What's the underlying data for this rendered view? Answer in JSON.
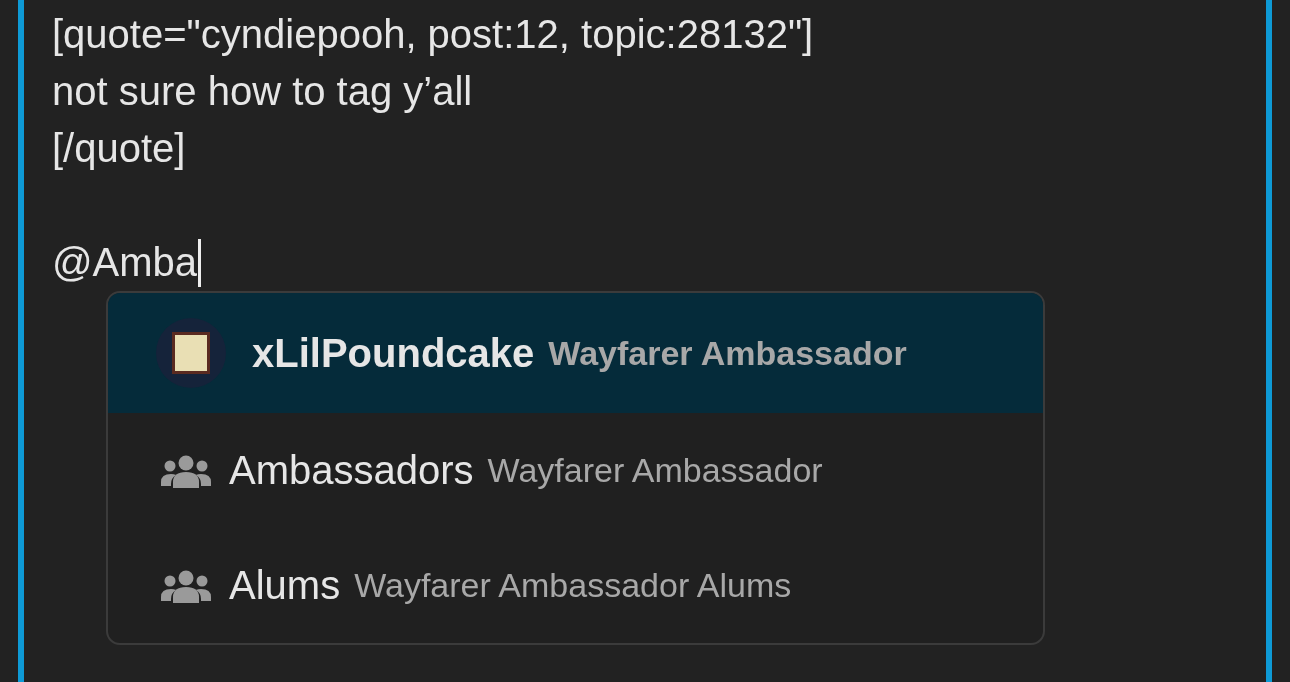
{
  "editor": {
    "lines": [
      "[quote=\"cyndiepooh, post:12, topic:28132\"]",
      "not sure how to tag y’all",
      "[/quote]"
    ],
    "typed": "@Amba"
  },
  "suggestions": [
    {
      "kind": "user",
      "name": "xLilPoundcake",
      "description": "Wayfarer Ambassador",
      "selected": true
    },
    {
      "kind": "group",
      "name": "Ambassadors",
      "description": "Wayfarer Ambassador",
      "selected": false
    },
    {
      "kind": "group",
      "name": "Alums",
      "description": "Wayfarer Ambassador Alums",
      "selected": false
    }
  ]
}
